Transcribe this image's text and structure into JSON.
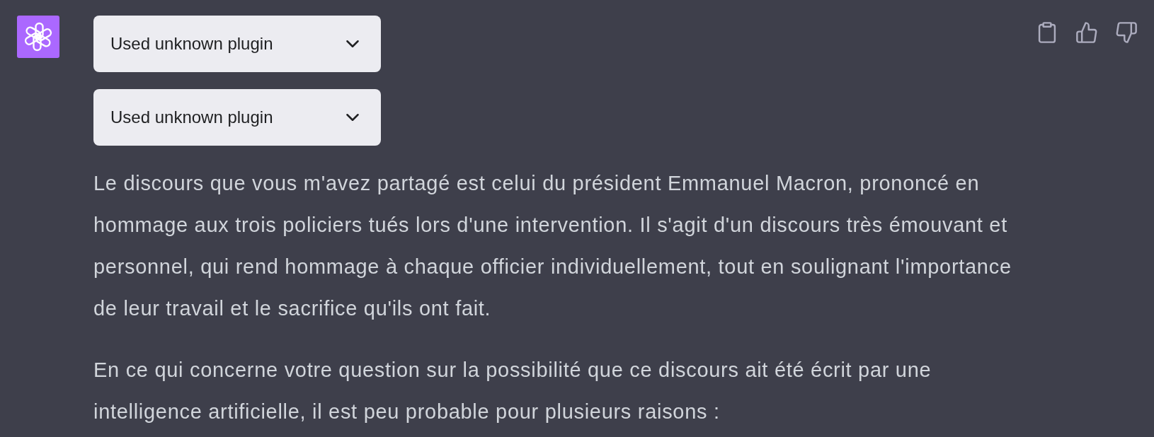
{
  "plugin_calls": [
    {
      "label": "Used unknown plugin",
      "expanded": false
    },
    {
      "label": "Used unknown plugin",
      "expanded": false
    }
  ],
  "paragraphs": [
    "Le discours que vous m'avez partagé est celui du président Emmanuel Macron, prononcé en hommage aux trois policiers tués lors d'une intervention. Il s'agit d'un discours très émouvant et personnel, qui rend hommage à chaque officier individuellement, tout en soulignant l'importance de leur travail et le sacrifice qu'ils ont fait.",
    "En ce qui concerne votre question sur la possibilité que ce discours ait été écrit par une intelligence artificielle, il est peu probable pour plusieurs raisons :"
  ]
}
